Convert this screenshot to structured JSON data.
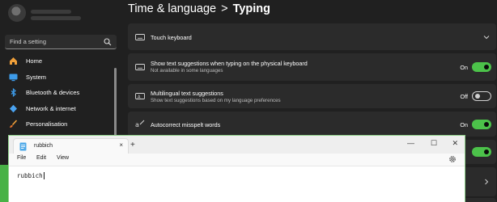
{
  "sidebar": {
    "search_placeholder": "Find a setting",
    "items": [
      {
        "label": "Home",
        "icon": "home-icon"
      },
      {
        "label": "System",
        "icon": "monitor-icon"
      },
      {
        "label": "Bluetooth & devices",
        "icon": "bluetooth-icon"
      },
      {
        "label": "Network & internet",
        "icon": "network-icon"
      },
      {
        "label": "Personalisation",
        "icon": "brush-icon"
      }
    ]
  },
  "breadcrumb": {
    "parent": "Time & language",
    "separator": ">",
    "current": "Typing"
  },
  "settings": [
    {
      "title": "Touch keyboard",
      "icon": "keyboard-icon"
    },
    {
      "title": "Show text suggestions when typing on the physical keyboard",
      "subtitle": "Not available in some languages",
      "state": "On",
      "icon": "keyboard-suggestions-icon",
      "enabled": true
    },
    {
      "title": "Multilingual text suggestions",
      "subtitle": "Show text suggestions based on my language preferences",
      "state": "Off",
      "icon": "multilingual-icon",
      "enabled": false
    },
    {
      "title": "Autocorrect misspelt words",
      "state": "On",
      "icon": "autocorrect-icon",
      "enabled": true
    }
  ],
  "notepad": {
    "tab_title": "rubbich",
    "tab_close": "×",
    "new_tab": "+",
    "minimize": "—",
    "maximize": "☐",
    "close": "✕",
    "menu": [
      "File",
      "Edit",
      "View"
    ],
    "content": "rubbich"
  },
  "colors": {
    "accent": "#4cc24a",
    "background": "#202020",
    "card": "#2b2b2b"
  }
}
